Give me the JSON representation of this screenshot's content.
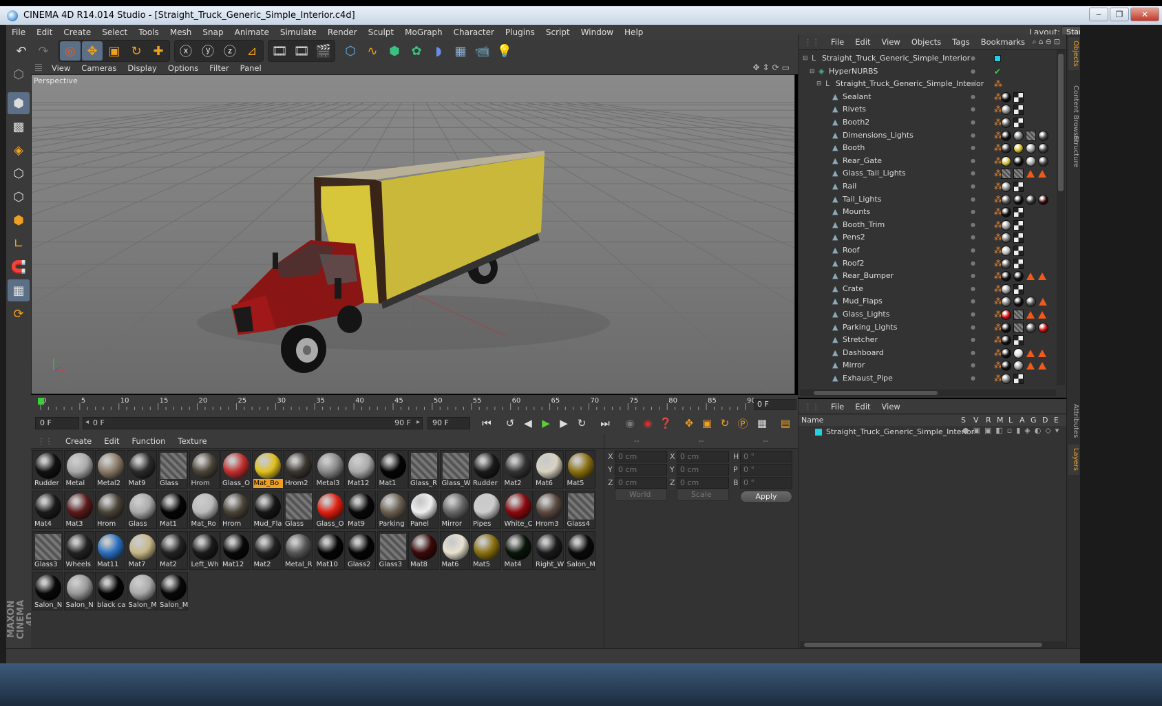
{
  "window": {
    "title": "CINEMA 4D R14.014 Studio - [Straight_Truck_Generic_Simple_Interior.c4d]",
    "min": "‒",
    "max": "❐",
    "close": "✕"
  },
  "menubar": {
    "items": [
      "File",
      "Edit",
      "Create",
      "Select",
      "Tools",
      "Mesh",
      "Snap",
      "Animate",
      "Simulate",
      "Render",
      "Sculpt",
      "MoGraph",
      "Character",
      "Plugins",
      "Script",
      "Window",
      "Help"
    ],
    "layout_label": "Layout:",
    "layout_value": "Startup (User)"
  },
  "viewport": {
    "menu": [
      "View",
      "Cameras",
      "Display",
      "Options",
      "Filter",
      "Panel"
    ],
    "label": "Perspective"
  },
  "timeline": {
    "ticks": [
      "0",
      "5",
      "10",
      "15",
      "20",
      "25",
      "30",
      "35",
      "40",
      "45",
      "50",
      "55",
      "60",
      "65",
      "70",
      "75",
      "80",
      "85",
      "90"
    ],
    "current_frame": "0 F"
  },
  "transport": {
    "start_field": "0 F",
    "range_start": "0 F",
    "range_end": "90 F",
    "end_field": "90 F"
  },
  "materials": {
    "menu": [
      "Create",
      "Edit",
      "Function",
      "Texture"
    ],
    "rows": [
      [
        {
          "n": "Rudder",
          "c": "#111"
        },
        {
          "n": "Metal",
          "c": "#aaa"
        },
        {
          "n": "Metal2",
          "c": "#8a7a66"
        },
        {
          "n": "Mat9",
          "c": "#2a2a2a"
        },
        {
          "n": "Glass",
          "c": "hatch"
        },
        {
          "n": "Hrom",
          "c": "#4a4438"
        },
        {
          "n": "Glass_O",
          "c": "#c03030"
        },
        {
          "n": "Mat_Bo",
          "c": "#e0c020",
          "sel": true
        },
        {
          "n": "Hrom2",
          "c": "#3a3630"
        },
        {
          "n": "Metal3",
          "c": "#888"
        },
        {
          "n": "Mat12",
          "c": "#aaa"
        },
        {
          "n": "Mat1",
          "c": "#050505"
        },
        {
          "n": "Glass_R",
          "c": "hatch"
        },
        {
          "n": "Glass_W",
          "c": "hatch2"
        },
        {
          "n": "Rudder",
          "c": "#1a1a1a"
        },
        {
          "n": "Mat2",
          "c": "#333"
        },
        {
          "n": "Mat6",
          "c": "#d8d2c0"
        },
        {
          "n": "Mat5",
          "c": "#8a7010"
        }
      ],
      [
        {
          "n": "Mat4",
          "c": "#1a1a1a"
        },
        {
          "n": "Mat3",
          "c": "#5a1a1a"
        },
        {
          "n": "Hrom",
          "c": "#4a4438"
        },
        {
          "n": "Glass",
          "c": "#aaa"
        },
        {
          "n": "Mat1",
          "c": "#050505"
        },
        {
          "n": "Mat_Ro",
          "c": "#bbb"
        },
        {
          "n": "Hrom",
          "c": "#4a4438"
        },
        {
          "n": "Mud_Fla",
          "c": "#151515"
        },
        {
          "n": "Glass",
          "c": "hatch"
        },
        {
          "n": "Glass_O",
          "c": "#e02010"
        },
        {
          "n": "Mat9",
          "c": "#080808"
        },
        {
          "n": "Parking",
          "c": "#6a6050"
        },
        {
          "n": "Panel",
          "c": "#eee"
        },
        {
          "n": "Mirror",
          "c": "#666"
        },
        {
          "n": "Pipes",
          "c": "#ccc"
        },
        {
          "n": "White_C",
          "c": "#8a0a10"
        },
        {
          "n": "Hrom3",
          "c": "#5a4a40"
        },
        {
          "n": "Glass4",
          "c": "hatch2"
        }
      ],
      [
        {
          "n": "Glass3",
          "c": "hatch"
        },
        {
          "n": "Wheels",
          "c": "#222"
        },
        {
          "n": "Mat11",
          "c": "#2a70c0"
        },
        {
          "n": "Mat7",
          "c": "#c8b888"
        },
        {
          "n": "Mat2",
          "c": "#222"
        },
        {
          "n": "Left_Wh",
          "c": "#1a1a1a"
        },
        {
          "n": "Mat12",
          "c": "#080808"
        },
        {
          "n": "Mat2",
          "c": "#222"
        },
        {
          "n": "Metal_R",
          "c": "#555"
        },
        {
          "n": "Mat10",
          "c": "#050505"
        },
        {
          "n": "Glass2",
          "c": "#050505"
        },
        {
          "n": "Glass3",
          "c": "hatch"
        },
        {
          "n": "Mat8",
          "c": "#3a0a0a"
        },
        {
          "n": "Mat6",
          "c": "#e8e2d0"
        },
        {
          "n": "Mat5",
          "c": "#8a7010"
        },
        {
          "n": "Mat4",
          "c": "#0a140a"
        },
        {
          "n": "Right_W",
          "c": "#1a1a1a"
        },
        {
          "n": "Salon_M",
          "c": "#0a0a0a"
        }
      ],
      [
        {
          "n": "Salon_N",
          "c": "#080808"
        },
        {
          "n": "Salon_N",
          "c": "#999"
        },
        {
          "n": "black ca",
          "c": "#050505"
        },
        {
          "n": "Salon_M",
          "c": "#aaa"
        },
        {
          "n": "Salon_M",
          "c": "#080808"
        }
      ]
    ]
  },
  "coords": {
    "header": [
      "--",
      "--",
      "--"
    ],
    "rows": [
      {
        "a": "X",
        "av": "0 cm",
        "b": "X",
        "bv": "0 cm",
        "c": "H",
        "cv": "0 °"
      },
      {
        "a": "Y",
        "av": "0 cm",
        "b": "Y",
        "bv": "0 cm",
        "c": "P",
        "cv": "0 °"
      },
      {
        "a": "Z",
        "av": "0 cm",
        "b": "Z",
        "bv": "0 cm",
        "c": "B",
        "cv": "0 °"
      }
    ],
    "world": "World",
    "scale": "Scale",
    "apply": "Apply"
  },
  "objects": {
    "menu": [
      "File",
      "Edit",
      "View",
      "Objects",
      "Tags",
      "Bookmarks"
    ],
    "items": [
      {
        "name": "Straight_Truck_Generic_Simple_Interior",
        "lvl": 0,
        "icon": "null",
        "tags": [
          "cyan"
        ]
      },
      {
        "name": "HyperNURBS",
        "lvl": 1,
        "icon": "nurbs",
        "tags": [
          "check"
        ]
      },
      {
        "name": "Straight_Truck_Generic_Simple_Interior",
        "lvl": 2,
        "icon": "null",
        "tags": [
          "ph"
        ]
      },
      {
        "name": "Sealant",
        "lvl": 3,
        "icon": "poly",
        "tags": [
          "ph",
          "#111",
          "chk"
        ]
      },
      {
        "name": "Rivets",
        "lvl": 3,
        "icon": "poly",
        "tags": [
          "ph",
          "#888",
          "chk"
        ]
      },
      {
        "name": "Booth2",
        "lvl": 3,
        "icon": "poly",
        "tags": [
          "ph",
          "#555",
          "chk"
        ]
      },
      {
        "name": "Dimensions_Lights",
        "lvl": 3,
        "icon": "poly",
        "tags": [
          "ph",
          "#111",
          "#777",
          "hatch",
          "#444"
        ]
      },
      {
        "name": "Booth",
        "lvl": 3,
        "icon": "poly",
        "tags": [
          "ph",
          "#333",
          "#d0b820",
          "#999",
          "#444"
        ]
      },
      {
        "name": "Rear_Gate",
        "lvl": 3,
        "icon": "poly",
        "tags": [
          "ph",
          "#d0c040",
          "#111",
          "#aaa",
          "#444"
        ]
      },
      {
        "name": "Glass_Tail_Lights",
        "lvl": 3,
        "icon": "poly",
        "tags": [
          "ph",
          "hatch",
          "hatch",
          "tri",
          "tri"
        ]
      },
      {
        "name": "Rail",
        "lvl": 3,
        "icon": "poly",
        "tags": [
          "ph",
          "#888",
          "chk"
        ]
      },
      {
        "name": "Tail_Lights",
        "lvl": 3,
        "icon": "poly",
        "tags": [
          "ph",
          "#555",
          "#111",
          "#333",
          "#3a0a0a"
        ]
      },
      {
        "name": "Mounts",
        "lvl": 3,
        "icon": "poly",
        "tags": [
          "ph",
          "#111",
          "chk"
        ]
      },
      {
        "name": "Booth_Trim",
        "lvl": 3,
        "icon": "poly",
        "tags": [
          "ph",
          "#999",
          "chk"
        ]
      },
      {
        "name": "Pens2",
        "lvl": 3,
        "icon": "poly",
        "tags": [
          "ph",
          "#777",
          "chk"
        ]
      },
      {
        "name": "Roof",
        "lvl": 3,
        "icon": "poly",
        "tags": [
          "ph",
          "#bbb",
          "chk"
        ]
      },
      {
        "name": "Roof2",
        "lvl": 3,
        "icon": "poly",
        "tags": [
          "ph",
          "#555",
          "chk"
        ]
      },
      {
        "name": "Rear_Bumper",
        "lvl": 3,
        "icon": "poly",
        "tags": [
          "ph",
          "#111",
          "#111",
          "tri",
          "tri"
        ]
      },
      {
        "name": "Crate",
        "lvl": 3,
        "icon": "poly",
        "tags": [
          "ph",
          "#999",
          "chk"
        ]
      },
      {
        "name": "Mud_Flaps",
        "lvl": 3,
        "icon": "poly",
        "tags": [
          "ph",
          "#777",
          "#111",
          "#555",
          "tri"
        ]
      },
      {
        "name": "Glass_Lights",
        "lvl": 3,
        "icon": "poly",
        "tags": [
          "ph",
          "#d01010",
          "hatch",
          "tri",
          "tri"
        ]
      },
      {
        "name": "Parking_Lights",
        "lvl": 3,
        "icon": "poly",
        "tags": [
          "ph",
          "#111",
          "hatch",
          "#555",
          "#d01010"
        ]
      },
      {
        "name": "Stretcher",
        "lvl": 3,
        "icon": "poly",
        "tags": [
          "ph",
          "#111",
          "chk"
        ]
      },
      {
        "name": "Dashboard",
        "lvl": 3,
        "icon": "poly",
        "tags": [
          "ph",
          "#111",
          "#ddd",
          "tri",
          "tri"
        ]
      },
      {
        "name": "Mirror",
        "lvl": 3,
        "icon": "poly",
        "tags": [
          "ph",
          "#111",
          "#999",
          "tri",
          "tri"
        ]
      },
      {
        "name": "Exhaust_Pipe",
        "lvl": 3,
        "icon": "poly",
        "tags": [
          "ph",
          "#777",
          "chk"
        ]
      }
    ]
  },
  "layers": {
    "menu": [
      "File",
      "Edit",
      "View"
    ],
    "columns": [
      "Name",
      "S",
      "V",
      "R",
      "M",
      "L",
      "A",
      "G",
      "D",
      "E"
    ],
    "row_name": "Straight_Truck_Generic_Simple_Interior"
  },
  "right_tabs": [
    "Objects",
    "Content Browser",
    "Structure",
    "Attributes",
    "Layers"
  ],
  "branding": "MAXON CINEMA 4D"
}
